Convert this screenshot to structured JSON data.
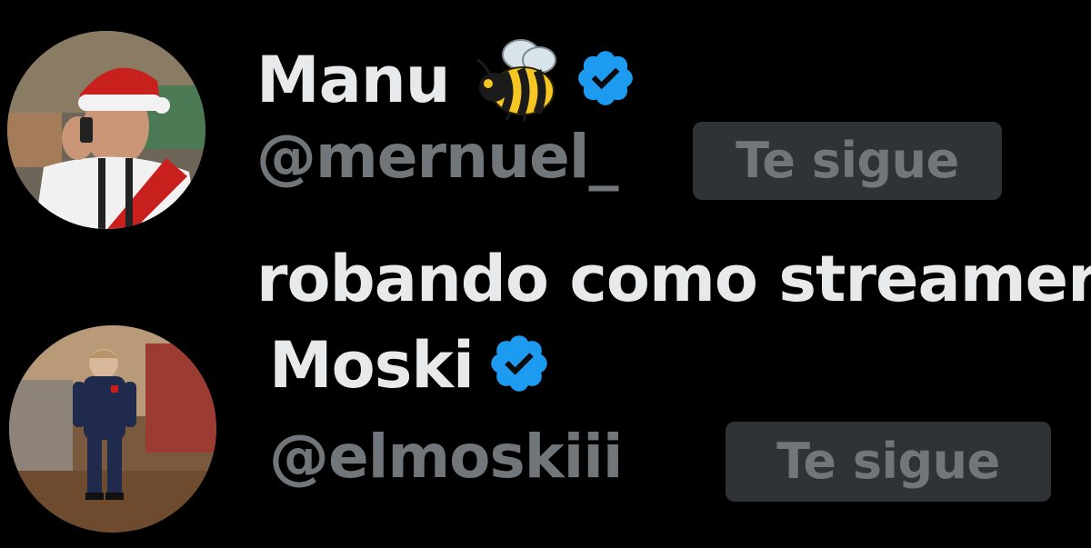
{
  "users": [
    {
      "display_name": "Manu",
      "emoji": "bee-emoji",
      "verified": true,
      "handle": "@mernuel_",
      "follows_you_label": "Te sigue",
      "bio": "robando como streamer"
    },
    {
      "display_name": "Moski",
      "verified": true,
      "handle": "@elmoskiii",
      "follows_you_label": "Te sigue"
    }
  ],
  "colors": {
    "background": "#000000",
    "primary_text": "#e7e9ea",
    "secondary_text": "#71767b",
    "badge_bg": "#2f3336",
    "verified_blue": "#1d9bf0"
  },
  "icons": {
    "verified": "verified-badge-icon",
    "bee": "bee-emoji"
  }
}
